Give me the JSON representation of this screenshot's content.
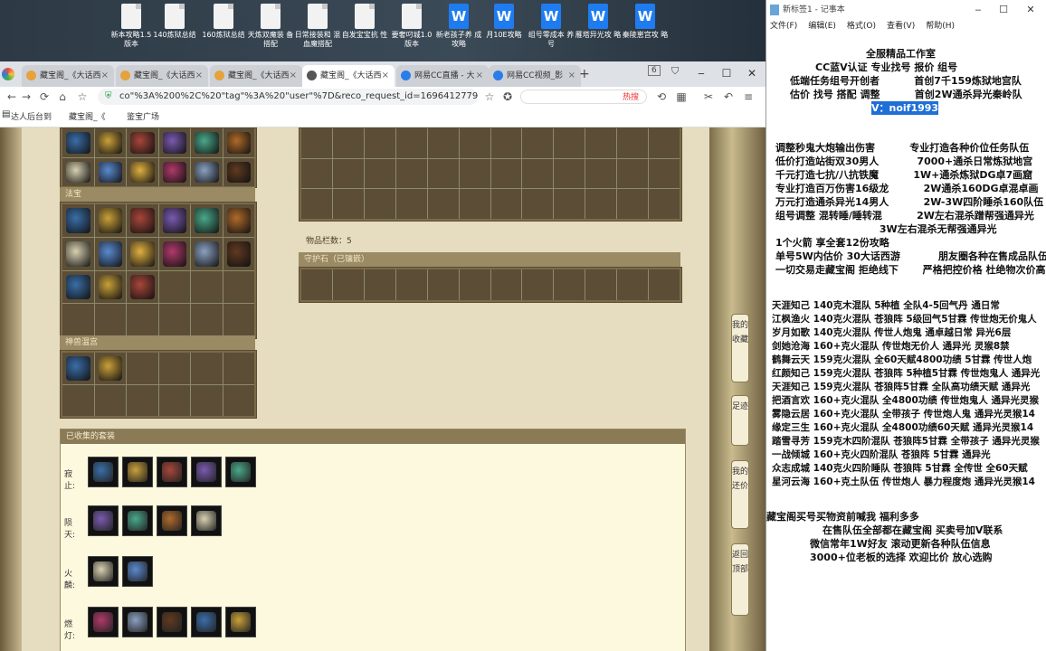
{
  "desktop": {
    "icons": [
      {
        "label": "新本攻略1.5 版本",
        "type": "doc"
      },
      {
        "label": "140炼狱总结",
        "type": "doc"
      },
      {
        "label": "160炼狱总结",
        "type": "doc"
      },
      {
        "label": "天炼双魔装 备搭配",
        "type": "doc"
      },
      {
        "label": "日常接装和 混血魔搭配",
        "type": "doc"
      },
      {
        "label": "自发宝宝抗 性",
        "type": "doc"
      },
      {
        "label": "要奢叼城1.0 版本",
        "type": "doc"
      },
      {
        "label": "新老孩子养 成攻略",
        "type": "wps"
      },
      {
        "label": "月10E攻略",
        "type": "wps"
      },
      {
        "label": "组号零成本 养号",
        "type": "wps"
      },
      {
        "label": "雁塔异光攻 略",
        "type": "wps"
      },
      {
        "label": "秦陵崽宫攻 略",
        "type": "wps"
      }
    ]
  },
  "browser": {
    "tabs": [
      {
        "label": "藏宝阁_《大话西",
        "active": false
      },
      {
        "label": "藏宝阁_《大话西",
        "active": false
      },
      {
        "label": "藏宝阁_《大话西",
        "active": false
      },
      {
        "label": "藏宝阁_《大话西",
        "active": true
      },
      {
        "label": "网易CC直播 - 大",
        "active": false
      },
      {
        "label": "网易CC视频_影",
        "active": false
      }
    ],
    "tab_count": "6",
    "new_tab": "+",
    "url": "co\"%3A%200%2C%20\"tag\"%3A%20\"user\"%7D&reco_request_id=1696412779968r1V7z",
    "search_hint": "热搜",
    "bookmarks": [
      "达人后台到",
      "藏宝阁_《",
      "鉴宝广场"
    ]
  },
  "page": {
    "fabao_title": "法宝",
    "shenshou_title": "神兽温宫",
    "item_count_label": "物品栏数：5",
    "guardian_title": "守护石（已镶嵌）",
    "collection_title": "已收集的套装",
    "collection_rows": [
      {
        "label": "寂止:",
        "count": 5
      },
      {
        "label": "陨天:",
        "count": 4
      },
      {
        "label": "火麟:",
        "count": 2
      },
      {
        "label": "燃灯:",
        "count": 5
      }
    ],
    "side_buttons": [
      "我的收藏",
      "足迹",
      "我的还价",
      "返回顶部"
    ]
  },
  "notepad": {
    "title": "新标签1 - 记事本",
    "menu": [
      "文件(F)",
      "编辑(E)",
      "格式(O)",
      "查看(V)",
      "帮助(H)"
    ],
    "lines": [
      "全服精品工作室",
      "CC蓝V认证 专业找号 报价 组号",
      "低端任务组号开创者          首创7千159炼狱地宫队",
      "估价 找号 搭配 调整          首创2W通杀异光秦岭队",
      "V：noif1993",
      "",
      "调整秒鬼大炮输出伤害          专业打造各种价位任务队伍",
      "低价打造站街双30男人           7000+通杀日常炼狱地宫",
      "千元打造七抗/八抗铁魔          1W+通杀炼狱DG卓7画窟",
      "专业打造百万伤害16级龙          2W通杀160DG卓混卓画",
      "万元打造通杀异光14男人          2W-3W四阶睡杀160队伍",
      "组号调整 混转睡/睡转混          2W左右混杀蹭帮强通异光",
      "                              3W左右混杀无帮强通异光",
      "1个火箭 享全套12份攻略",
      "单号5W内估价 30大话西游           朋友圈各种在售成品队伍",
      "一切交易走藏宝阁 拒绝线下       严格把控价格 杜绝物次价高",
      "",
      "天涯知己 140克木混队 5种植 全队4-5回气丹 通日常",
      "江枫渔火 140克火混队 苍狼阵 5级回气5甘霖 传世炮无价鬼人",
      "岁月如歌 140克火混队 传世人炮鬼 通卓越日常 异光6层",
      "剑她沧海 160+克火混队 传世炮无价人 通异光 灵猴8禁",
      "鹤舞云天 159克火混队 全60天赋4800功绩 5甘霖 传世人炮",
      "红颜知己 159克火混队 苍狼阵 5种植5甘霖 传世炮鬼人 通异光",
      "天涯知己 159克火混队 苍狼阵5甘霖 全队高功绩天赋 通异光",
      "把酒言欢 160+克火混队 全4800功绩 传世炮鬼人 通异光灵猴",
      "雾隐云居 160+克火混队 全带孩子 传世炮人鬼 通异光灵猴14",
      "缘定三生 160+克火混队 全4800功绩60天赋 通异光灵猴14",
      "踏雪寻芳 159克木四阶混队 苍狼阵5甘霖 全带孩子 通异光灵猴",
      "一战倾城 160+克火四阶混队 苍狼阵 5甘霖 通异光",
      "众志成城 140克火四阶睡队 苍狼阵 5甘霖 全传世 全60天赋",
      "星河云海 160+克土队伍 传世炮人 暴力程度炮 通异光灵猴14",
      "",
      "藏宝阁买号买物资前喊我 福利多多",
      "在售队伍全部都在藏宝阁 买卖号加V联系",
      "微信常年1W好友 滚动更新各种队伍信息",
      "3000+位老板的选择 欢迎比价 放心选购"
    ]
  },
  "colors": {
    "accent": "#1e6fd6",
    "page_bg": "#e6dcc0",
    "panel": "#7a6a48"
  }
}
